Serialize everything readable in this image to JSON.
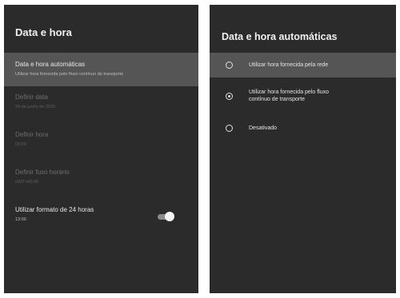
{
  "left_screen": {
    "title": "Data e hora",
    "items": [
      {
        "title": "Data e hora automáticas",
        "subtitle": "Utilizar hora fornecida pelo fluxo contínuo de transporte",
        "state": "selected"
      },
      {
        "title": "Definir data",
        "subtitle": "24 de junho de 2020",
        "state": "disabled"
      },
      {
        "title": "Definir hora",
        "subtitle": "09:59",
        "state": "disabled"
      },
      {
        "title": "Definir fuso horário",
        "subtitle": "GMT+00:00",
        "state": "disabled"
      },
      {
        "title": "Utilizar formato de 24 horas",
        "subtitle": "13:00",
        "state": "enabled",
        "toggle_on": true
      }
    ]
  },
  "right_screen": {
    "title": "Data e hora automáticas",
    "options": [
      {
        "label_lines": [
          "Utilizar hora fornecida pela rede"
        ],
        "selected": false,
        "focused": true
      },
      {
        "label_lines": [
          "Utilizar hora fornecida pelo fluxo",
          "contínuo de transporte"
        ],
        "selected": true,
        "focused": false
      },
      {
        "label_lines": [
          "Desativado"
        ],
        "selected": false,
        "focused": false
      }
    ]
  }
}
